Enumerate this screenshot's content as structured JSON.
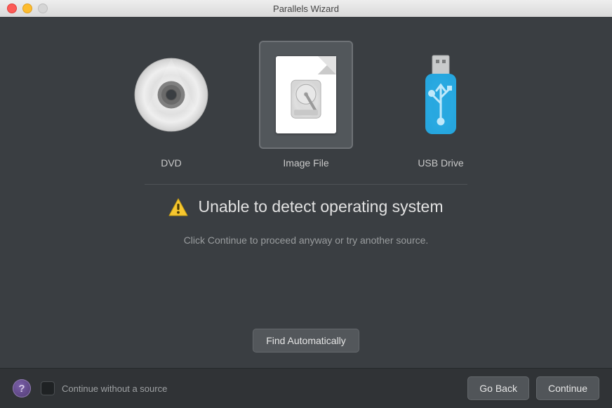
{
  "window": {
    "title": "Parallels Wizard"
  },
  "sources": {
    "dvd": {
      "label": "DVD",
      "selected": false
    },
    "image": {
      "label": "Image File",
      "selected": true
    },
    "usb": {
      "label": "USB Drive",
      "selected": false
    }
  },
  "message": {
    "heading": "Unable to detect operating system",
    "sub": "Click Continue to proceed anyway or try another source."
  },
  "buttons": {
    "find": "Find Automatically",
    "back": "Go Back",
    "continue": "Continue"
  },
  "footer": {
    "checkbox_label": "Continue without a source",
    "checked": false
  }
}
